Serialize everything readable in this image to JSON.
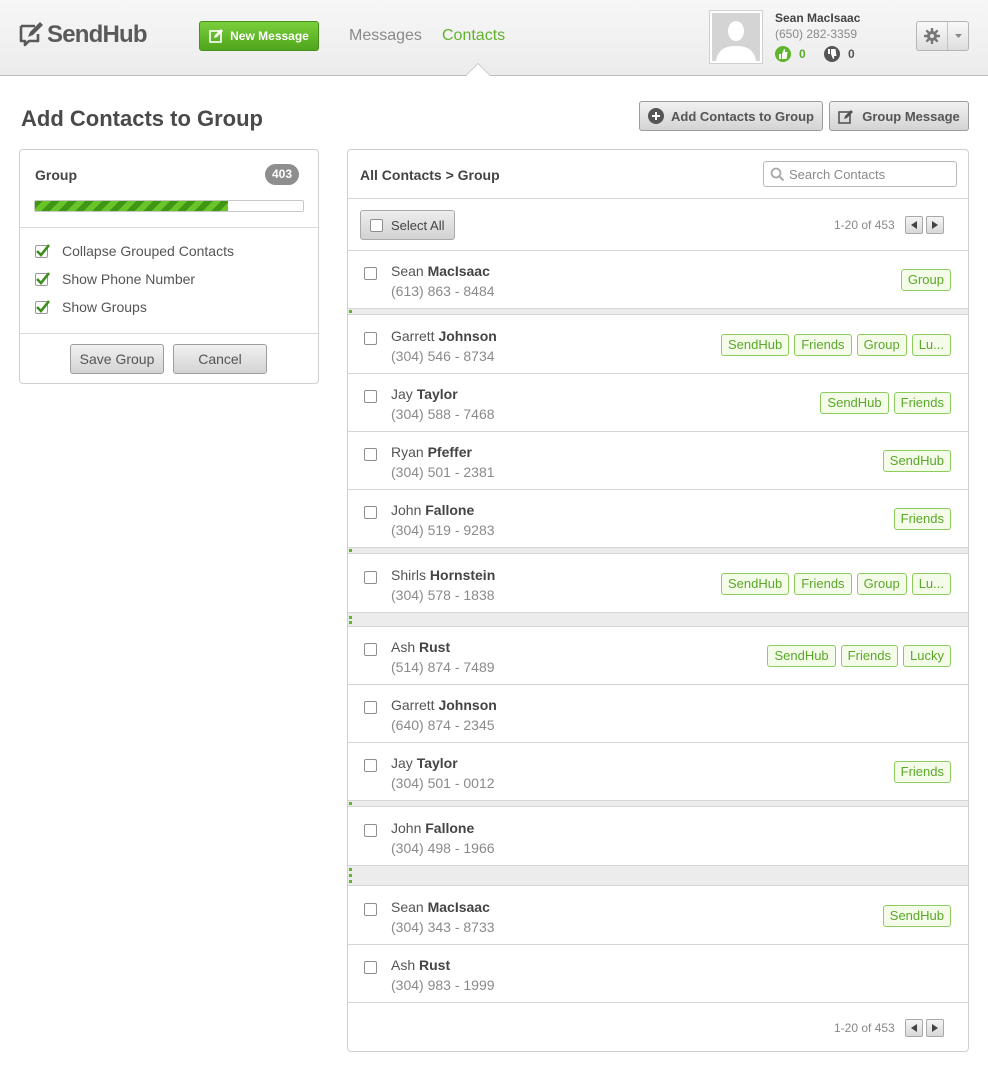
{
  "header": {
    "logo_text": "SendHub",
    "new_message_label": "New Message",
    "nav": {
      "messages": "Messages",
      "contacts": "Contacts"
    },
    "user": {
      "name": "Sean MacIsaac",
      "phone": "(650) 282-3359",
      "thumbs_up_count": "0",
      "thumbs_down_count": "0"
    }
  },
  "page": {
    "title": "Add Contacts to Group"
  },
  "actions": {
    "add_contacts_label": "Add Contacts to Group",
    "group_message_label": "Group Message"
  },
  "left_panel": {
    "title": "Group",
    "count": "403",
    "progress_fraction": 0.72,
    "options": [
      {
        "label": "Collapse Grouped Contacts",
        "checked": true
      },
      {
        "label": "Show Phone Number",
        "checked": true
      },
      {
        "label": "Show Groups",
        "checked": true
      }
    ],
    "save_label": "Save Group",
    "cancel_label": "Cancel"
  },
  "right_panel": {
    "breadcrumb": "All Contacts > Group",
    "search_placeholder": "Search Contacts",
    "select_all_label": "Select All",
    "pagination_top": "1-20 of 453",
    "pagination_bottom": "1-20 of 453"
  },
  "contacts": [
    {
      "first": "Sean",
      "last": "MacIsaac",
      "phone": "(613) 863 - 8484",
      "tags": [
        "Group"
      ]
    },
    {
      "first": "Garrett",
      "last": "Johnson",
      "phone": "(304) 546 - 8734",
      "tags": [
        "SendHub",
        "Friends",
        "Group",
        "Lu..."
      ]
    },
    {
      "first": "Jay",
      "last": "Taylor",
      "phone": "(304) 588 - 7468",
      "tags": [
        "SendHub",
        "Friends"
      ]
    },
    {
      "first": "Ryan",
      "last": "Pfeffer",
      "phone": "(304) 501 - 2381",
      "tags": [
        "SendHub"
      ]
    },
    {
      "first": "John",
      "last": "Fallone",
      "phone": "(304) 519 - 9283",
      "tags": [
        "Friends"
      ]
    },
    {
      "first": "Shirls",
      "last": "Hornstein",
      "phone": "(304) 578 - 1838",
      "tags": [
        "SendHub",
        "Friends",
        "Group",
        "Lu..."
      ]
    },
    {
      "first": "Ash",
      "last": "Rust",
      "phone": "(514) 874 - 7489",
      "tags": [
        "SendHub",
        "Friends",
        "Lucky"
      ]
    },
    {
      "first": "Garrett",
      "last": "Johnson",
      "phone": "(640) 874 - 2345",
      "tags": []
    },
    {
      "first": "Jay",
      "last": "Taylor",
      "phone": "(304) 501 - 0012",
      "tags": [
        "Friends"
      ]
    },
    {
      "first": "John",
      "last": "Fallone",
      "phone": "(304) 498 - 1966",
      "tags": []
    },
    {
      "first": "Sean",
      "last": "MacIsaac",
      "phone": "(304) 343 - 8733",
      "tags": [
        "SendHub"
      ]
    },
    {
      "first": "Ash",
      "last": "Rust",
      "phone": "(304) 983 - 1999",
      "tags": []
    }
  ]
}
